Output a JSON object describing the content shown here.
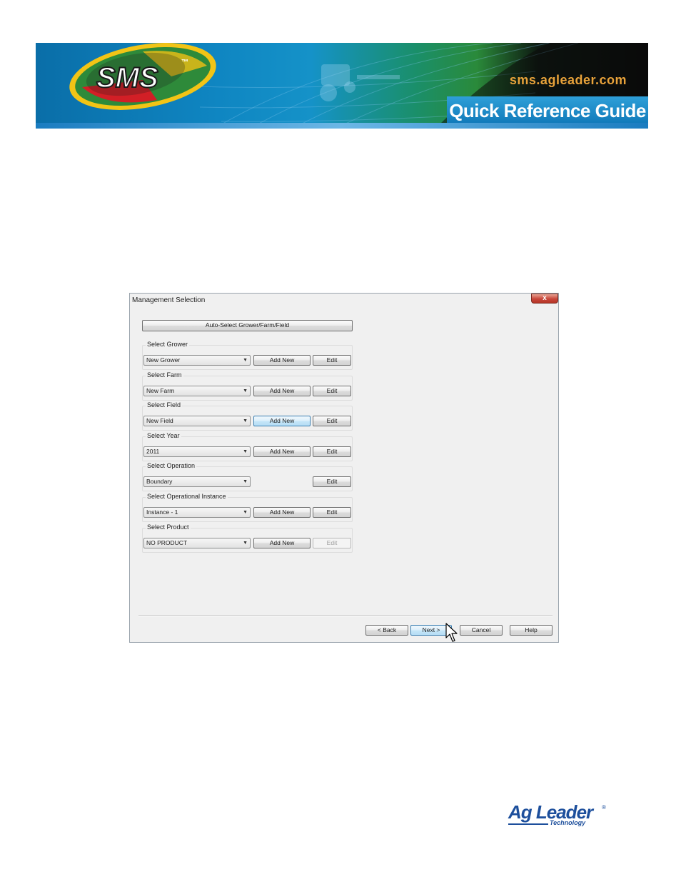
{
  "banner": {
    "logo_text": "SMS",
    "logo_tm": "™",
    "url": "sms.agleader.com",
    "guide_title": "Quick Reference Guide"
  },
  "dialog": {
    "title": "Management Selection",
    "close_label": "x",
    "auto_select_label": "Auto-Select Grower/Farm/Field",
    "groups": [
      {
        "label": "Select Grower",
        "value": "New Grower",
        "add_label": "Add New",
        "edit_label": "Edit"
      },
      {
        "label": "Select Farm",
        "value": "New Farm",
        "add_label": "Add New",
        "edit_label": "Edit"
      },
      {
        "label": "Select Field",
        "value": "New Field",
        "add_label": "Add New",
        "edit_label": "Edit"
      },
      {
        "label": "Select Year",
        "value": "2011",
        "add_label": "Add New",
        "edit_label": "Edit"
      },
      {
        "label": "Select Operation",
        "value": "Boundary",
        "edit_label": "Edit"
      },
      {
        "label": "Select Operational Instance",
        "value": "Instance - 1",
        "add_label": "Add New",
        "edit_label": "Edit"
      },
      {
        "label": "Select Product",
        "value": "NO PRODUCT",
        "add_label": "Add New",
        "edit_label": "Edit"
      }
    ],
    "footer": {
      "back_label": "< Back",
      "next_label": "Next >",
      "cancel_label": "Cancel",
      "help_label": "Help"
    }
  },
  "footer_logo": {
    "brand": "Ag Leader",
    "registered": "®",
    "tagline": "Technology"
  },
  "colors": {
    "accent_orange": "#e8a23a",
    "guide_blue": "#1a8ad0",
    "brand_blue": "#1d4f9c"
  }
}
